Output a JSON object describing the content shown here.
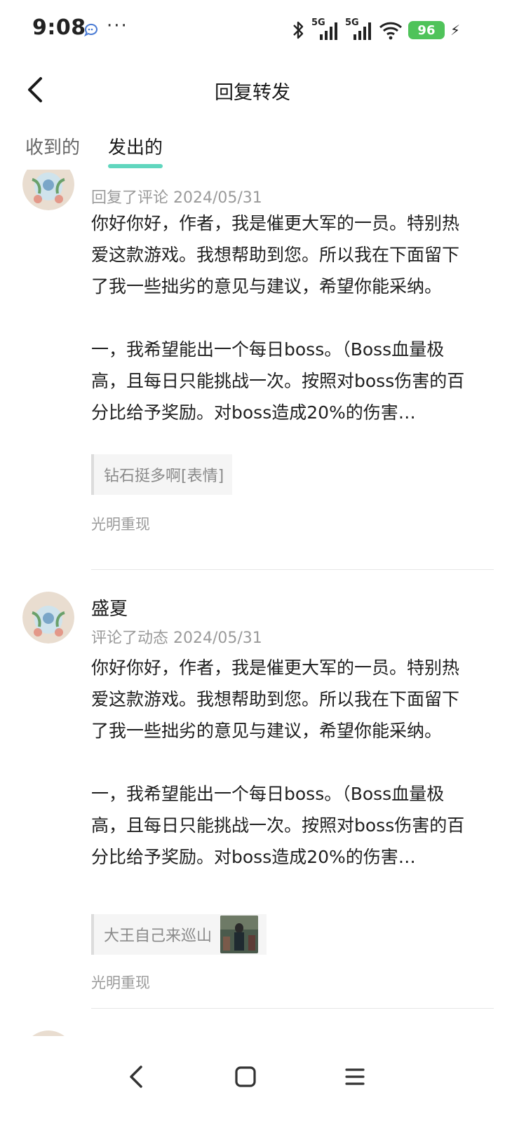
{
  "status_bar": {
    "time": "9:08",
    "more": "···",
    "net1": "5G",
    "net2": "5G",
    "battery": "96"
  },
  "header": {
    "title": "回复转发"
  },
  "tabs": [
    {
      "label": "收到的",
      "active": false
    },
    {
      "label": "发出的",
      "active": true
    }
  ],
  "items": [
    {
      "name": "",
      "meta": "回复了评论 2024/05/31",
      "text": "你好你好，作者，我是催更大军的一员。特别热爱这款游戏。我想帮助到您。所以我在下面留下了我一些拙劣的意见与建议，希望你能采纳。\n\n一，我希望能出一个每日boss。（Boss血量极高，且每日只能挑战一次。按照对boss伤害的百分比给予奖励。对boss造成20%的伤害…",
      "quote": "钻石挺多啊[表情]",
      "circle": "光明重现"
    },
    {
      "name": "盛夏",
      "meta": "评论了动态 2024/05/31",
      "text": "你好你好，作者，我是催更大军的一员。特别热爱这款游戏。我想帮助到您。所以我在下面留下了我一些拙劣的意见与建议，希望你能采纳。\n\n一，我希望能出一个每日boss。（Boss血量极高，且每日只能挑战一次。按照对boss伤害的百分比给予奖励。对boss造成20%的伤害…",
      "quote": "大王自己来巡山",
      "circle": "光明重现"
    }
  ],
  "colors": {
    "accent": "#4fd1b7",
    "battery": "#4fc35a",
    "muted": "#9a9a9a"
  }
}
